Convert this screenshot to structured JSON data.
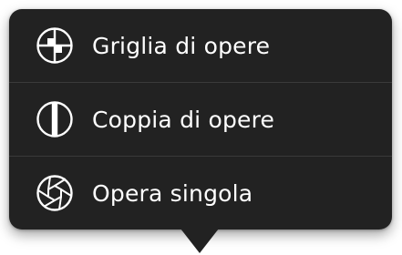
{
  "menu": {
    "items": [
      {
        "label": "Griglia di opere",
        "icon": "grid-icon"
      },
      {
        "label": "Coppia di opere",
        "icon": "split-pair-icon"
      },
      {
        "label": "Opera singola",
        "icon": "aperture-icon"
      }
    ]
  },
  "colors": {
    "background": "#222222",
    "text": "#ffffff",
    "divider": "#3a3a3a"
  }
}
